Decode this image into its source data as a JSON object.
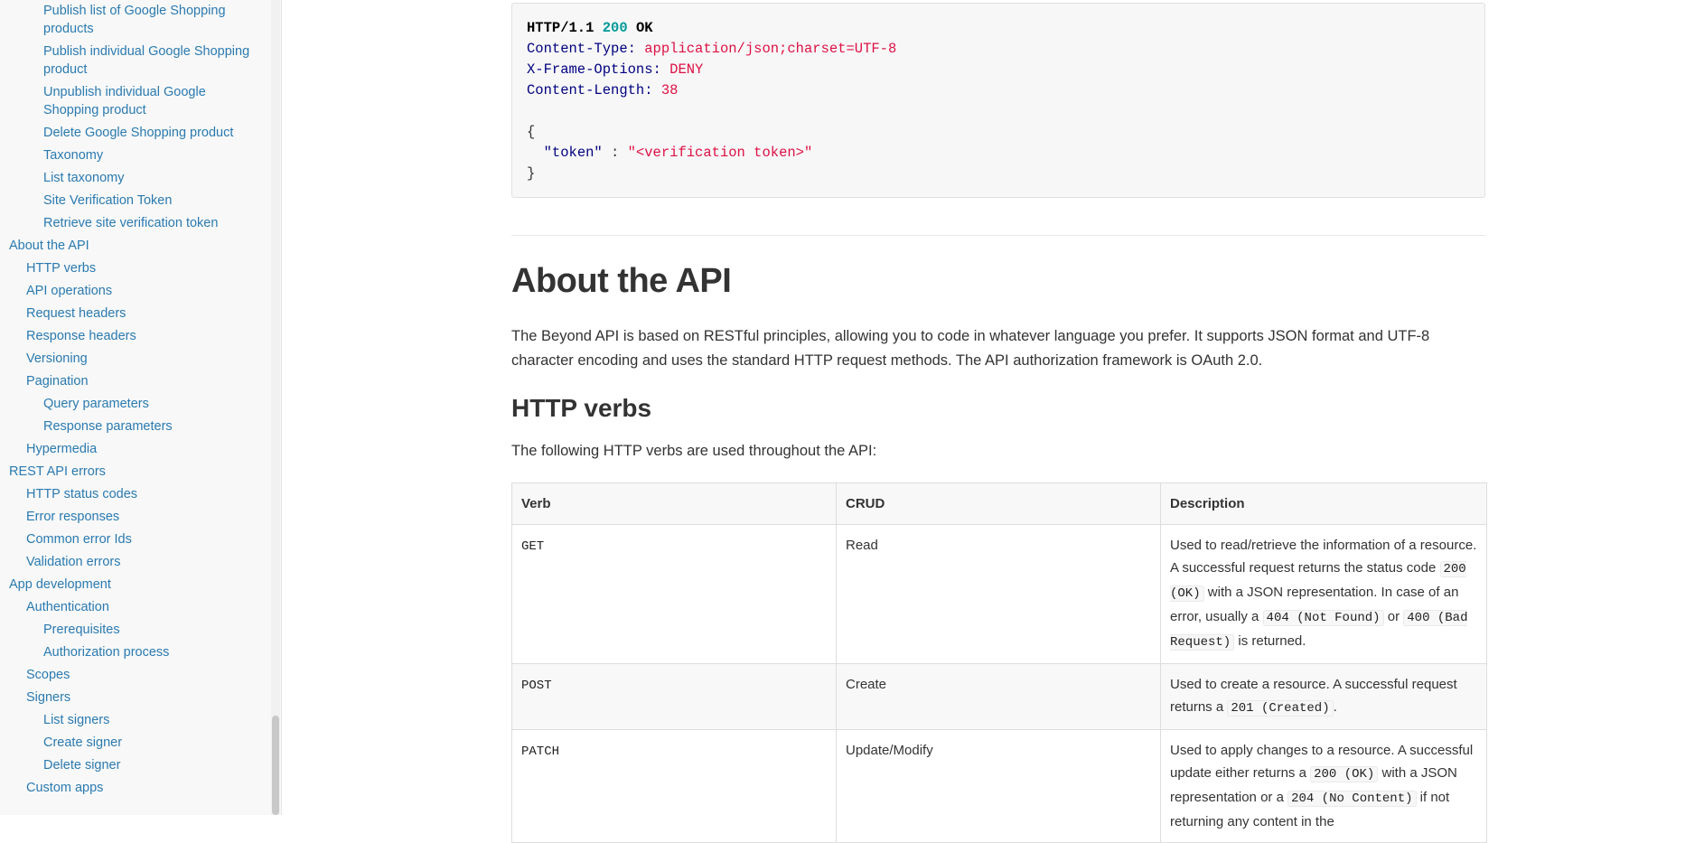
{
  "sidebar": {
    "items": [
      {
        "label": "Publish list of Google Shopping products",
        "level": 2
      },
      {
        "label": "Publish individual Google Shopping product",
        "level": 2
      },
      {
        "label": "Unpublish individual Google Shopping product",
        "level": 2
      },
      {
        "label": "Delete Google Shopping product",
        "level": 2
      },
      {
        "label": "Taxonomy",
        "level": 2
      },
      {
        "label": "List taxonomy",
        "level": 2
      },
      {
        "label": "Site Verification Token",
        "level": 2
      },
      {
        "label": "Retrieve site verification token",
        "level": 2
      },
      {
        "label": "About the API",
        "level": 0
      },
      {
        "label": "HTTP verbs",
        "level": 1
      },
      {
        "label": "API operations",
        "level": 1
      },
      {
        "label": "Request headers",
        "level": 1
      },
      {
        "label": "Response headers",
        "level": 1
      },
      {
        "label": "Versioning",
        "level": 1
      },
      {
        "label": "Pagination",
        "level": 1
      },
      {
        "label": "Query parameters",
        "level": 2
      },
      {
        "label": "Response parameters",
        "level": 2
      },
      {
        "label": "Hypermedia",
        "level": 1
      },
      {
        "label": "REST API errors",
        "level": 0
      },
      {
        "label": "HTTP status codes",
        "level": 1
      },
      {
        "label": "Error responses",
        "level": 1
      },
      {
        "label": "Common error Ids",
        "level": 1
      },
      {
        "label": "Validation errors",
        "level": 1
      },
      {
        "label": "App development",
        "level": 0
      },
      {
        "label": "Authentication",
        "level": 1
      },
      {
        "label": "Prerequisites",
        "level": 2
      },
      {
        "label": "Authorization process",
        "level": 2
      },
      {
        "label": "Scopes",
        "level": 1
      },
      {
        "label": "Signers",
        "level": 1
      },
      {
        "label": "List signers",
        "level": 2
      },
      {
        "label": "Create signer",
        "level": 2
      },
      {
        "label": "Delete signer",
        "level": 2
      },
      {
        "label": "Custom apps",
        "level": 1
      }
    ]
  },
  "code": {
    "status_proto": "HTTP/1.1",
    "status_code": "200",
    "status_text": "OK",
    "h1_key": "Content-Type:",
    "h1_val": "application/json;charset=UTF-8",
    "h2_key": "X-Frame-Options:",
    "h2_val": "DENY",
    "h3_key": "Content-Length:",
    "h3_val": "38",
    "brace_open": "{",
    "json_key": "\"token\"",
    "json_sep": " : ",
    "json_val": "\"<verification token>\"",
    "brace_close": "}"
  },
  "main": {
    "heading": "About the API",
    "intro": "The Beyond API is based on RESTful principles, allowing you to code in whatever language you prefer. It supports JSON format and UTF-8 character encoding and uses the standard HTTP request methods. The API authorization framework is OAuth 2.0.",
    "subheading": "HTTP verbs",
    "subintro": "The following HTTP verbs are used throughout the API:"
  },
  "table": {
    "headers": [
      "Verb",
      "CRUD",
      "Description"
    ],
    "rows": [
      {
        "verb": "GET",
        "crud": "Read",
        "d1": "Used to read/retrieve the information of a resource. A successful request returns the status code ",
        "c1": "200 (OK)",
        "d2": " with a JSON representation. In case of an error, usually a ",
        "c2": "404 (Not Found)",
        "d3": " or ",
        "c3": "400 (Bad Request)",
        "d4": " is returned."
      },
      {
        "verb": "POST",
        "crud": "Create",
        "d1": "Used to create a resource. A successful request returns a ",
        "c1": "201 (Created)",
        "d2": "."
      },
      {
        "verb": "PATCH",
        "crud": "Update/Modify",
        "d1": "Used to apply changes to a resource. A successful update either returns a ",
        "c1": "200 (OK)",
        "d2": " with a JSON representation or a ",
        "c2": "204 (No Content)",
        "d3": " if not returning any content in the"
      }
    ]
  },
  "colors": {
    "link": "#2a7ab0",
    "code_key": "#000080",
    "code_string": "#dd1144",
    "code_number": "#009999"
  }
}
